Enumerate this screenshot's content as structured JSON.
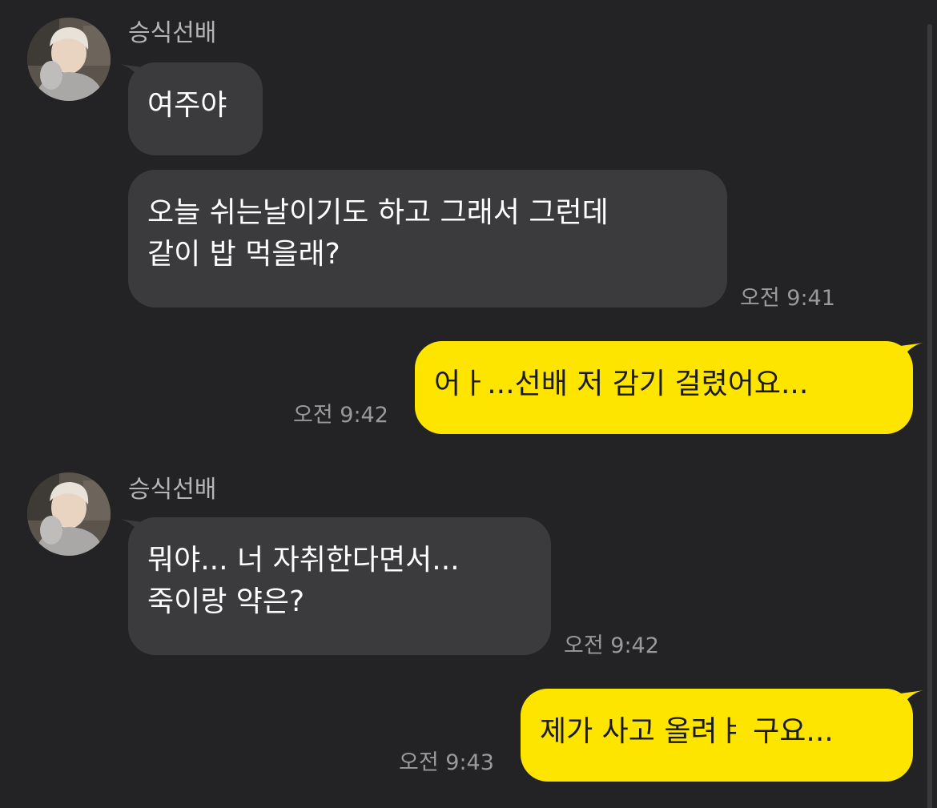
{
  "colors": {
    "background": "#232325",
    "incoming_bubble": "#3b3b3e",
    "outgoing_bubble": "#fee500",
    "time_text": "#9a9a9d",
    "sender_text": "#b5b5b8"
  },
  "messages": [
    {
      "direction": "in",
      "sender": "승식선배",
      "avatar": "profile-photo",
      "bubbles": [
        {
          "text": "여주야"
        },
        {
          "text": "오늘 쉬는날이기도 하고 그래서 그런데\n같이 밥 먹을래?",
          "time": "오전 9:41"
        }
      ]
    },
    {
      "direction": "out",
      "bubbles": [
        {
          "text": "어ㅏ...선배 저 감기 걸렸어요...",
          "time": "오전 9:42"
        }
      ]
    },
    {
      "direction": "in",
      "sender": "승식선배",
      "avatar": "profile-photo",
      "bubbles": [
        {
          "text": "뭐야... 너 자취한다면서...\n죽이랑 약은?",
          "time": "오전 9:42"
        }
      ]
    },
    {
      "direction": "out",
      "bubbles": [
        {
          "text": "제가 사고 올려ㅑ 구요...",
          "time": "오전 9:43"
        }
      ]
    }
  ]
}
